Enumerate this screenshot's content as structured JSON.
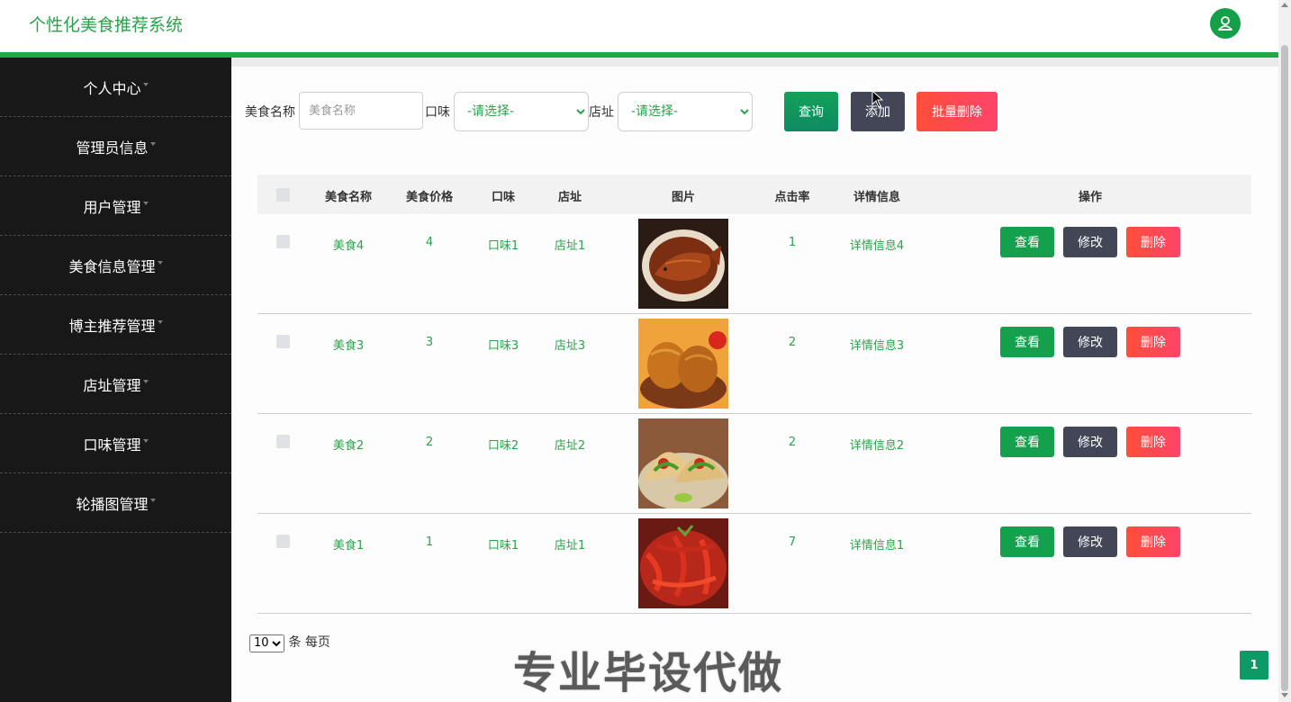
{
  "app": {
    "title": "个性化美食推荐系统"
  },
  "sidebar": {
    "items": [
      {
        "label": "个人中心"
      },
      {
        "label": "管理员信息"
      },
      {
        "label": "用户管理"
      },
      {
        "label": "美食信息管理"
      },
      {
        "label": "博主推荐管理"
      },
      {
        "label": "店址管理"
      },
      {
        "label": "口味管理"
      },
      {
        "label": "轮播图管理"
      }
    ]
  },
  "search": {
    "name_label": "美食名称",
    "name_placeholder": "美食名称",
    "taste_label": "口味",
    "taste_selected": "-请选择-",
    "address_label": "店址",
    "address_selected": "-请选择-",
    "query_label": "查询",
    "add_label": "添加",
    "batch_delete_label": "批量删除"
  },
  "table": {
    "headers": {
      "name": "美食名称",
      "price": "美食价格",
      "taste": "口味",
      "address": "店址",
      "image": "图片",
      "click_rate": "点击率",
      "details": "详情信息",
      "actions": "操作"
    },
    "rows": [
      {
        "name": "美食4",
        "price": "4",
        "taste": "口味1",
        "address": "店址1",
        "image": "braised-fish",
        "click_rate": "1",
        "details": "详情信息4"
      },
      {
        "name": "美食3",
        "price": "3",
        "taste": "口味3",
        "address": "店址3",
        "image": "fried-chicken",
        "click_rate": "2",
        "details": "详情信息3"
      },
      {
        "name": "美食2",
        "price": "2",
        "taste": "口味2",
        "address": "店址2",
        "image": "tacos",
        "click_rate": "2",
        "details": "详情信息2"
      },
      {
        "name": "美食1",
        "price": "1",
        "taste": "口味1",
        "address": "店址1",
        "image": "crayfish",
        "click_rate": "7",
        "details": "详情信息1"
      }
    ],
    "view_label": "查看",
    "edit_label": "修改",
    "delete_label": "删除"
  },
  "pagination": {
    "page_size": "10",
    "per_page_text": "条 每页",
    "current_page": "1"
  },
  "watermark": "专业毕设代做",
  "colors": {
    "brand_green": "#1fa945",
    "sidebar_bg": "#181818",
    "query_btn": "#13a060",
    "add_btn": "#424656",
    "delete_btn": "#ff4d4d"
  }
}
